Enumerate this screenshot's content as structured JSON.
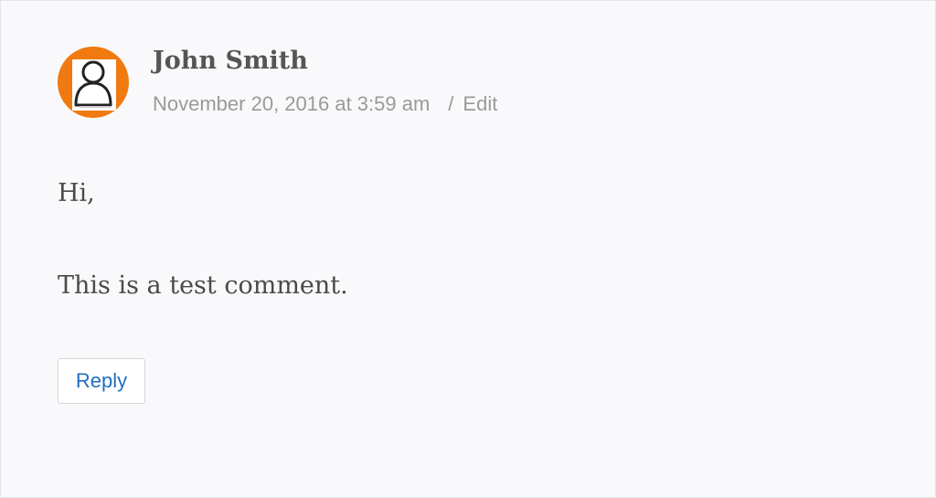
{
  "comment": {
    "author": "John Smith",
    "date": "November 20, 2016 at 3:59 am",
    "separator": "/",
    "edit_label": "Edit",
    "paragraphs": [
      "Hi,",
      "This is a test comment."
    ],
    "reply_label": "Reply",
    "avatar_icon": "default-user-avatar-icon"
  },
  "colors": {
    "avatar_bg": "#f07a10",
    "link": "#1e6fbf",
    "meta_text": "#9a9a9a",
    "body_text": "#4a4a4a"
  }
}
